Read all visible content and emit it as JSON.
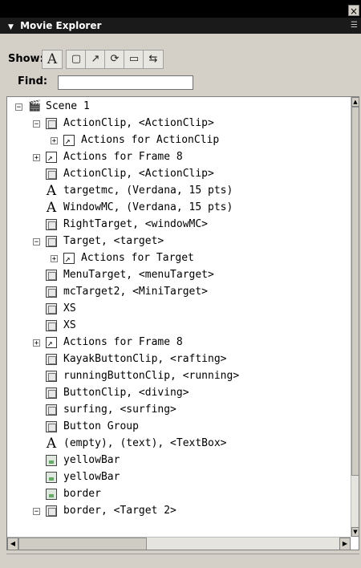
{
  "window": {
    "close_glyph": "×"
  },
  "panel": {
    "title": "Movie Explorer",
    "collapse_glyph": "▼",
    "menu_glyph": "☰"
  },
  "show": {
    "label": "Show:",
    "buttons": [
      {
        "name": "show-text-button",
        "glyph": "A"
      },
      {
        "name": "show-buttons-clips-button",
        "glyph": "▢"
      },
      {
        "name": "show-actions-button",
        "glyph": "↗"
      },
      {
        "name": "show-video-sound-button",
        "glyph": "⟳"
      },
      {
        "name": "show-frames-layers-button",
        "glyph": "▭"
      },
      {
        "name": "customize-filter-button",
        "glyph": "⇆"
      }
    ]
  },
  "find": {
    "label": "Find:",
    "value": ""
  },
  "tree": {
    "rows": [
      {
        "text": "Scene 1",
        "icon": "scene",
        "indent": 0,
        "expander": "minus"
      },
      {
        "text": "ActionClip, <ActionClip>",
        "icon": "clip",
        "indent": 1,
        "expander": "minus"
      },
      {
        "text": "Actions for ActionClip",
        "icon": "action",
        "indent": 2,
        "expander": "plus"
      },
      {
        "text": "Actions for Frame 8",
        "icon": "action",
        "indent": 1,
        "expander": "plus"
      },
      {
        "text": "ActionClip, <ActionClip>",
        "icon": "clip",
        "indent": 1,
        "expander": ""
      },
      {
        "text": "targetmc, (Verdana, 15 pts)",
        "icon": "text",
        "indent": 1,
        "expander": ""
      },
      {
        "text": "WindowMC, (Verdana, 15 pts)",
        "icon": "text",
        "indent": 1,
        "expander": ""
      },
      {
        "text": "RightTarget, <windowMC>",
        "icon": "clip",
        "indent": 1,
        "expander": ""
      },
      {
        "text": "Target, <target>",
        "icon": "clip",
        "indent": 1,
        "expander": "minus"
      },
      {
        "text": "Actions for Target",
        "icon": "action",
        "indent": 2,
        "expander": "plus"
      },
      {
        "text": "MenuTarget, <menuTarget>",
        "icon": "clip",
        "indent": 1,
        "expander": ""
      },
      {
        "text": "mcTarget2, <MiniTarget>",
        "icon": "clip",
        "indent": 1,
        "expander": ""
      },
      {
        "text": "XS",
        "icon": "clip",
        "indent": 1,
        "expander": ""
      },
      {
        "text": "XS",
        "icon": "clip",
        "indent": 1,
        "expander": ""
      },
      {
        "text": "Actions for Frame 8",
        "icon": "action",
        "indent": 1,
        "expander": "plus"
      },
      {
        "text": "KayakButtonClip, <rafting>",
        "icon": "clip",
        "indent": 1,
        "expander": ""
      },
      {
        "text": "runningButtonClip, <running>",
        "icon": "clip",
        "indent": 1,
        "expander": ""
      },
      {
        "text": "ButtonClip, <diving>",
        "icon": "clip",
        "indent": 1,
        "expander": ""
      },
      {
        "text": "surfing, <surfing>",
        "icon": "clip",
        "indent": 1,
        "expander": ""
      },
      {
        "text": "Button Group",
        "icon": "clip",
        "indent": 1,
        "expander": ""
      },
      {
        "text": "(empty), (text), <TextBox>",
        "icon": "text",
        "indent": 1,
        "expander": ""
      },
      {
        "text": "yellowBar",
        "icon": "graphic",
        "indent": 1,
        "expander": ""
      },
      {
        "text": "yellowBar",
        "icon": "graphic",
        "indent": 1,
        "expander": ""
      },
      {
        "text": "border",
        "icon": "graphic",
        "indent": 1,
        "expander": ""
      },
      {
        "text": "border, <Target 2>",
        "icon": "clip",
        "indent": 1,
        "expander": "minus"
      }
    ]
  },
  "scroll": {
    "up": "▲",
    "down": "▼",
    "left": "◀",
    "right": "▶"
  }
}
